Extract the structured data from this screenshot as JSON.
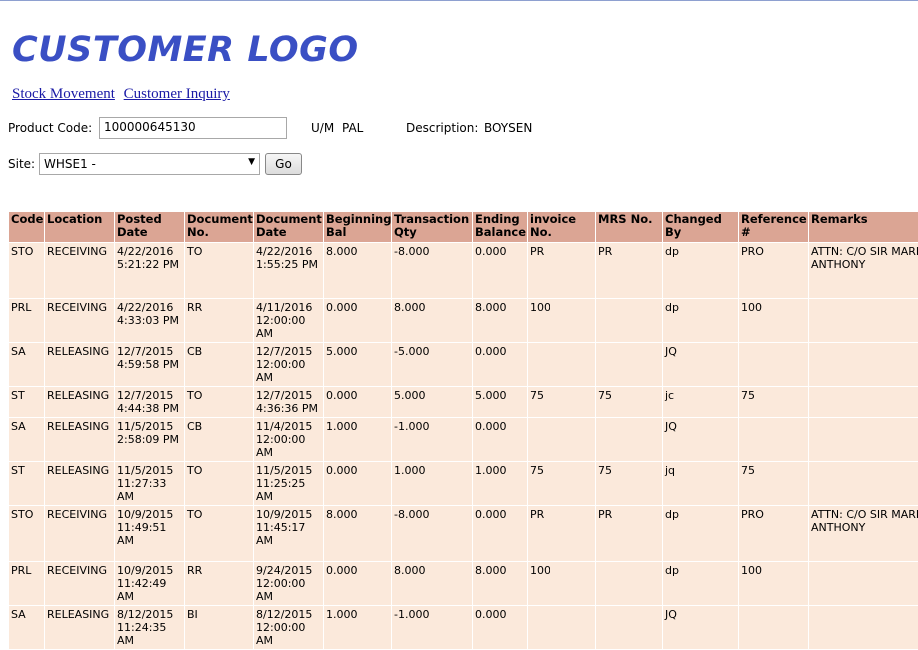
{
  "header": {
    "logo_text": "CUSTOMER LOGO"
  },
  "nav": {
    "links": [
      "Stock Movement",
      "Customer Inquiry"
    ]
  },
  "filters": {
    "product_code_label": "Product Code:",
    "product_code_value": "100000645130",
    "um_label": "U/M",
    "um_value": "PAL",
    "description_label": "Description:",
    "description_value": "BOYSEN",
    "site_label": "Site:",
    "site_value": "WHSE1 -",
    "go_label": "Go"
  },
  "table": {
    "columns": [
      "Code",
      "Location",
      "Posted Date",
      "Document No.",
      "Document Date",
      "Beginning Bal",
      "Transaction Qty",
      "Ending Balance",
      "invoice No.",
      "MRS No.",
      "Changed By",
      "Reference #",
      "Remarks"
    ],
    "rows": [
      [
        "STO",
        "RECEIVING",
        "4/22/2016 5:21:22 PM",
        "TO",
        "4/22/2016 1:55:25 PM",
        "8.000",
        "-8.000",
        "0.000",
        "PR",
        "PR",
        "dp",
        "PRO",
        "ATTN: C/O SIR MARK ANTHONY"
      ],
      [
        "PRL",
        "RECEIVING",
        "4/22/2016 4:33:03 PM",
        "RR",
        "4/11/2016 12:00:00 AM",
        "0.000",
        "8.000",
        "8.000",
        "100",
        "",
        "dp",
        "100",
        ""
      ],
      [
        "SA",
        "RELEASING",
        "12/7/2015 4:59:58 PM",
        "CB",
        "12/7/2015 12:00:00 AM",
        "5.000",
        "-5.000",
        "0.000",
        "",
        "",
        "JQ",
        "",
        ""
      ],
      [
        "ST",
        "RELEASING",
        "12/7/2015 4:44:38 PM",
        "TO",
        "12/7/2015 4:36:36 PM",
        "0.000",
        "5.000",
        "5.000",
        "75",
        "75",
        "jc",
        "75",
        ""
      ],
      [
        "SA",
        "RELEASING",
        "11/5/2015 2:58:09 PM",
        "CB",
        "11/4/2015 12:00:00 AM",
        "1.000",
        "-1.000",
        "0.000",
        "",
        "",
        "JQ",
        "",
        ""
      ],
      [
        "ST",
        "RELEASING",
        "11/5/2015 11:27:33 AM",
        "TO",
        "11/5/2015 11:25:25 AM",
        "0.000",
        "1.000",
        "1.000",
        "75",
        "75",
        "jq",
        "75",
        ""
      ],
      [
        "STO",
        "RECEIVING",
        "10/9/2015 11:49:51 AM",
        "TO",
        "10/9/2015 11:45:17 AM",
        "8.000",
        "-8.000",
        "0.000",
        "PR",
        "PR",
        "dp",
        "PRO",
        "ATTN: C/O SIR MARK ANTHONY"
      ],
      [
        "PRL",
        "RECEIVING",
        "10/9/2015 11:42:49 AM",
        "RR",
        "9/24/2015 12:00:00 AM",
        "0.000",
        "8.000",
        "8.000",
        "100",
        "",
        "dp",
        "100",
        ""
      ],
      [
        "SA",
        "RELEASING",
        "8/12/2015 11:24:35 AM",
        "BI",
        "8/12/2015 12:00:00 AM",
        "1.000",
        "-1.000",
        "0.000",
        "",
        "",
        "JQ",
        "",
        ""
      ]
    ]
  }
}
